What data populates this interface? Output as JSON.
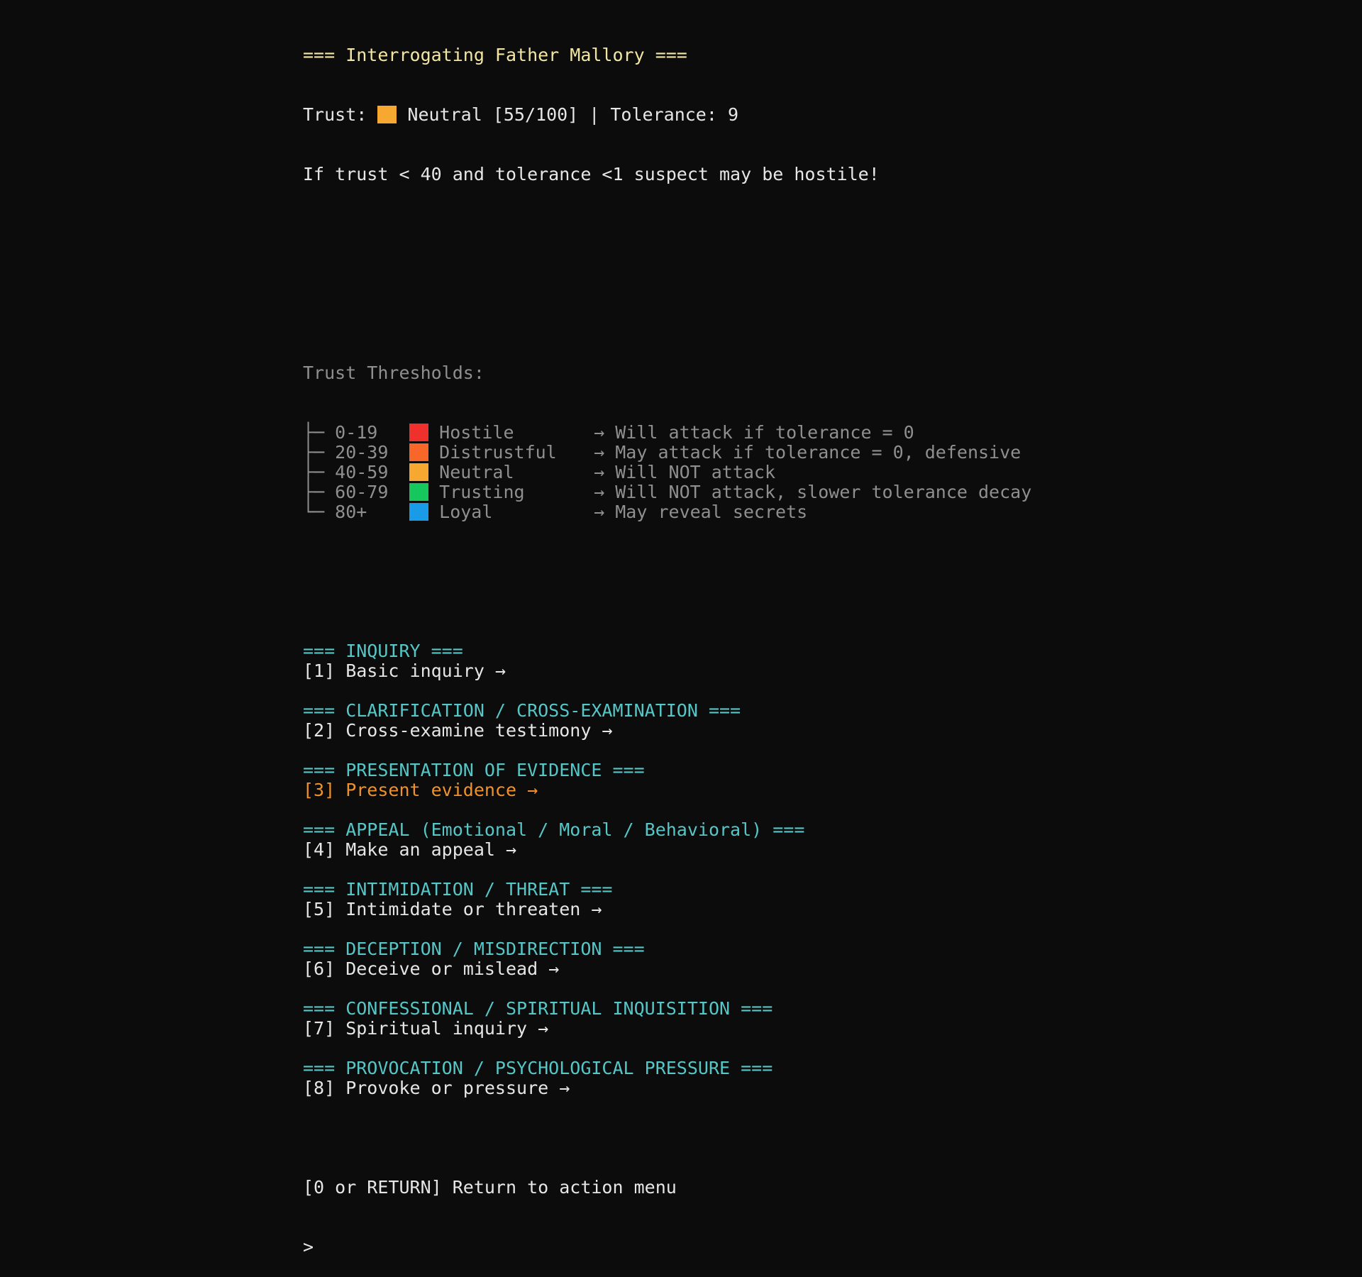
{
  "colors": {
    "background": "#0c0c0c",
    "title": "#f2e6a2",
    "section": "#56c6c6",
    "selected": "#f0922b",
    "dim": "#8f8f8f",
    "text": "#e6e6e6"
  },
  "header": {
    "title": "=== Interrogating Father Mallory ===",
    "trust_label": "Trust: ",
    "trust_color": "#f7a830",
    "trust_text": " Neutral [55/100] | Tolerance: 9",
    "trust_value": 55,
    "trust_max": 100,
    "tolerance": 9,
    "warning": "If trust < 40 and tolerance <1 suspect may be hostile!"
  },
  "thresholds": {
    "heading": "Trust Thresholds:",
    "rows": [
      {
        "tree": "├─ ",
        "range": "0-19",
        "color": "#f0302c",
        "name": "Hostile",
        "effect": "→ Will attack if tolerance = 0"
      },
      {
        "tree": "├─ ",
        "range": "20-39",
        "color": "#f7672a",
        "name": "Distrustful",
        "effect": "→ May attack if tolerance = 0, defensive"
      },
      {
        "tree": "├─ ",
        "range": "40-59",
        "color": "#f7a830",
        "name": "Neutral",
        "effect": "→ Will NOT attack"
      },
      {
        "tree": "├─ ",
        "range": "60-79",
        "color": "#16c75e",
        "name": "Trusting",
        "effect": "→ Will NOT attack, slower tolerance decay"
      },
      {
        "tree": "└─ ",
        "range": "80+",
        "color": "#1a9be8",
        "name": "Loyal",
        "effect": "→ May reveal secrets"
      }
    ]
  },
  "sections": [
    {
      "heading": "=== INQUIRY ===",
      "option": "[1] Basic inquiry →",
      "selected": false
    },
    {
      "heading": "=== CLARIFICATION / CROSS-EXAMINATION ===",
      "option": "[2] Cross-examine testimony →",
      "selected": false
    },
    {
      "heading": "=== PRESENTATION OF EVIDENCE ===",
      "option": "[3] Present evidence →",
      "selected": true
    },
    {
      "heading": "=== APPEAL (Emotional / Moral / Behavioral) ===",
      "option": "[4] Make an appeal →",
      "selected": false
    },
    {
      "heading": "=== INTIMIDATION / THREAT ===",
      "option": "[5] Intimidate or threaten →",
      "selected": false
    },
    {
      "heading": "=== DECEPTION / MISDIRECTION ===",
      "option": "[6] Deceive or mislead →",
      "selected": false
    },
    {
      "heading": "=== CONFESSIONAL / SPIRITUAL INQUISITION ===",
      "option": "[7] Spiritual inquiry →",
      "selected": false
    },
    {
      "heading": "=== PROVOCATION / PSYCHOLOGICAL PRESSURE ===",
      "option": "[8] Provoke or pressure →",
      "selected": false
    }
  ],
  "footer": {
    "return_option": "[0 or RETURN] Return to action menu",
    "prompt": ">"
  }
}
